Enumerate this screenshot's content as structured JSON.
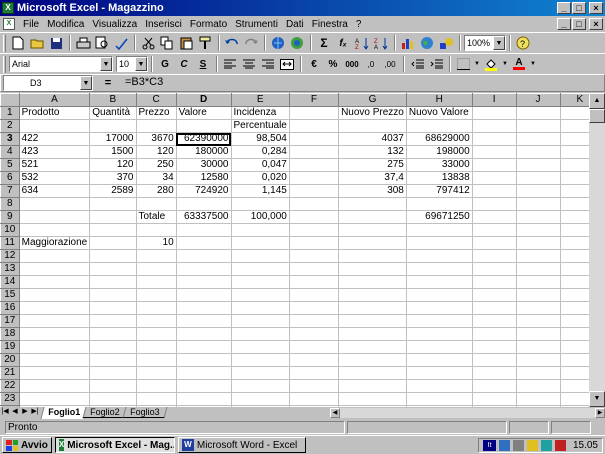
{
  "window": {
    "title": "Microsoft Excel - Magazzino",
    "min": "_",
    "max": "□",
    "close": "×",
    "app_icon": "X"
  },
  "menu": [
    "File",
    "Modifica",
    "Visualizza",
    "Inserisci",
    "Formato",
    "Strumenti",
    "Dati",
    "Finestra",
    "?"
  ],
  "toolbar": {
    "zoom": "100%",
    "font": "Arial",
    "font_size": "10",
    "bold": "G",
    "italic": "C",
    "underline": "S",
    "sum": "Σ",
    "fx": "fₓ",
    "currency": "€",
    "percent": "%",
    "thousands": "000",
    "inc_dec": ",0",
    "dec_dec": ",00",
    "font_color": "A"
  },
  "formula_bar": {
    "name_box": "D3",
    "equals": "=",
    "formula": "=B3*C3"
  },
  "grid": {
    "columns": [
      "A",
      "B",
      "C",
      "D",
      "E",
      "F",
      "G",
      "H",
      "I",
      "J",
      "K"
    ],
    "selected_col": "D",
    "selected_row": "3",
    "rows": [
      {
        "n": "1",
        "cells": [
          "Prodotto",
          "Quantità",
          "Prezzo",
          "Valore",
          "Incidenza",
          "",
          "Nuovo Prezzo",
          "Nuovo Valore",
          "",
          "",
          ""
        ]
      },
      {
        "n": "2",
        "cells": [
          "",
          "",
          "",
          "",
          "Percentuale",
          "",
          "",
          "",
          "",
          "",
          ""
        ]
      },
      {
        "n": "3",
        "cells": [
          "422",
          "17000",
          "3670",
          "62390000",
          "98,504",
          "",
          "4037",
          "68629000",
          "",
          "",
          ""
        ]
      },
      {
        "n": "4",
        "cells": [
          "423",
          "1500",
          "120",
          "180000",
          "0,284",
          "",
          "132",
          "198000",
          "",
          "",
          ""
        ]
      },
      {
        "n": "5",
        "cells": [
          "521",
          "120",
          "250",
          "30000",
          "0,047",
          "",
          "275",
          "33000",
          "",
          "",
          ""
        ]
      },
      {
        "n": "6",
        "cells": [
          "532",
          "370",
          "34",
          "12580",
          "0,020",
          "",
          "37,4",
          "13838",
          "",
          "",
          ""
        ]
      },
      {
        "n": "7",
        "cells": [
          "634",
          "2589",
          "280",
          "724920",
          "1,145",
          "",
          "308",
          "797412",
          "",
          "",
          ""
        ]
      },
      {
        "n": "8",
        "cells": [
          "",
          "",
          "",
          "",
          "",
          "",
          "",
          "",
          "",
          "",
          ""
        ]
      },
      {
        "n": "9",
        "cells": [
          "",
          "",
          "Totale",
          "63337500",
          "100,000",
          "",
          "",
          "69671250",
          "",
          "",
          ""
        ]
      },
      {
        "n": "10",
        "cells": [
          "",
          "",
          "",
          "",
          "",
          "",
          "",
          "",
          "",
          "",
          ""
        ]
      },
      {
        "n": "11",
        "cells": [
          "Maggiorazione",
          "",
          "10",
          "",
          "",
          "",
          "",
          "",
          "",
          "",
          ""
        ]
      },
      {
        "n": "12",
        "cells": [
          "",
          "",
          "",
          "",
          "",
          "",
          "",
          "",
          "",
          "",
          ""
        ]
      },
      {
        "n": "13",
        "cells": [
          "",
          "",
          "",
          "",
          "",
          "",
          "",
          "",
          "",
          "",
          ""
        ]
      },
      {
        "n": "14",
        "cells": [
          "",
          "",
          "",
          "",
          "",
          "",
          "",
          "",
          "",
          "",
          ""
        ]
      },
      {
        "n": "15",
        "cells": [
          "",
          "",
          "",
          "",
          "",
          "",
          "",
          "",
          "",
          "",
          ""
        ]
      },
      {
        "n": "16",
        "cells": [
          "",
          "",
          "",
          "",
          "",
          "",
          "",
          "",
          "",
          "",
          ""
        ]
      },
      {
        "n": "17",
        "cells": [
          "",
          "",
          "",
          "",
          "",
          "",
          "",
          "",
          "",
          "",
          ""
        ]
      },
      {
        "n": "18",
        "cells": [
          "",
          "",
          "",
          "",
          "",
          "",
          "",
          "",
          "",
          "",
          ""
        ]
      },
      {
        "n": "19",
        "cells": [
          "",
          "",
          "",
          "",
          "",
          "",
          "",
          "",
          "",
          "",
          ""
        ]
      },
      {
        "n": "20",
        "cells": [
          "",
          "",
          "",
          "",
          "",
          "",
          "",
          "",
          "",
          "",
          ""
        ]
      },
      {
        "n": "21",
        "cells": [
          "",
          "",
          "",
          "",
          "",
          "",
          "",
          "",
          "",
          "",
          ""
        ]
      },
      {
        "n": "22",
        "cells": [
          "",
          "",
          "",
          "",
          "",
          "",
          "",
          "",
          "",
          "",
          ""
        ]
      },
      {
        "n": "23",
        "cells": [
          "",
          "",
          "",
          "",
          "",
          "",
          "",
          "",
          "",
          "",
          ""
        ]
      },
      {
        "n": "24",
        "cells": [
          "",
          "",
          "",
          "",
          "",
          "",
          "",
          "",
          "",
          "",
          ""
        ]
      }
    ]
  },
  "sheets": [
    "Foglio1",
    "Foglio2",
    "Foglio3"
  ],
  "active_sheet": "Foglio1",
  "status": "Pronto",
  "taskbar": {
    "start": "Avvio",
    "tasks": [
      "Microsoft Excel - Mag...",
      "Microsoft Word - Excel"
    ],
    "tray_lang": "It",
    "clock": "15.05"
  },
  "colors": {
    "title_start": "#000080",
    "title_end": "#1084d0",
    "face": "#c0c0c0"
  }
}
